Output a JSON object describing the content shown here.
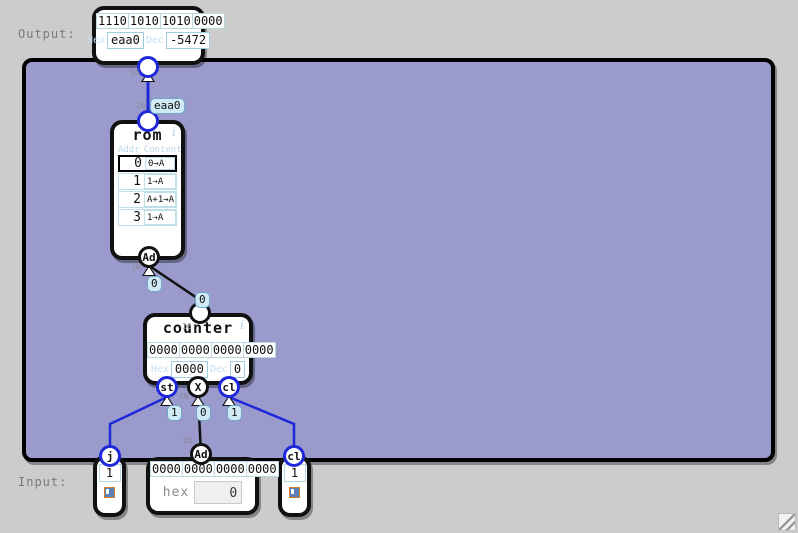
{
  "labels": {
    "output": "Output:",
    "input": "Input:"
  },
  "output_module": {
    "name": "output-display",
    "bits": [
      "1110",
      "1010",
      "1010",
      "0000"
    ],
    "hex_tag": "Hex",
    "hex_value": "eaa0",
    "dec_tag": "Dec",
    "dec_value": "-5472"
  },
  "rom": {
    "title": "rom",
    "info_icon": "i",
    "col_addr": "Addr",
    "col_content": "Content",
    "rows": [
      {
        "addr": "0",
        "content": "0→A",
        "selected": true
      },
      {
        "addr": "1",
        "content": "1⇢A",
        "selected": false
      },
      {
        "addr": "2",
        "content": "A+1→A",
        "selected": false
      },
      {
        "addr": "3",
        "content": "1⇢A",
        "selected": false
      }
    ],
    "input_port": "Ad",
    "input_port_width": "16"
  },
  "counter": {
    "title": "counter",
    "info_icon": "i",
    "bits": [
      "0000",
      "0000",
      "0000",
      "0000"
    ],
    "hex_tag": "Hex",
    "hex_value": "0000",
    "dec_tag": "Dec",
    "dec_value": "0",
    "ports": [
      {
        "name": "st",
        "value": "1"
      },
      {
        "name": "X",
        "value": "0"
      },
      {
        "name": "cl",
        "value": "1"
      }
    ],
    "clock_width": "16"
  },
  "inputs": [
    {
      "name": "j",
      "value": "1",
      "checked": true
    },
    {
      "name": "cl",
      "value": "1",
      "checked": true
    }
  ],
  "input_ad": {
    "name": "Ad",
    "bits": [
      "0000",
      "0000",
      "0000",
      "0000"
    ],
    "hex_label": "hex",
    "hex_value": "0",
    "width": "16"
  },
  "wire_values": {
    "out_to_rom": "eaa0",
    "rom_out_width": "16",
    "rom_addr_in": "0",
    "counter_out": "0",
    "counter_out_width": "16"
  },
  "colors": {
    "canvas": "#9a9acd",
    "page": "#cccccc",
    "wire_blue": "#1f28d8",
    "wire_black": "#111111",
    "bubble": "#cfeaf5"
  }
}
